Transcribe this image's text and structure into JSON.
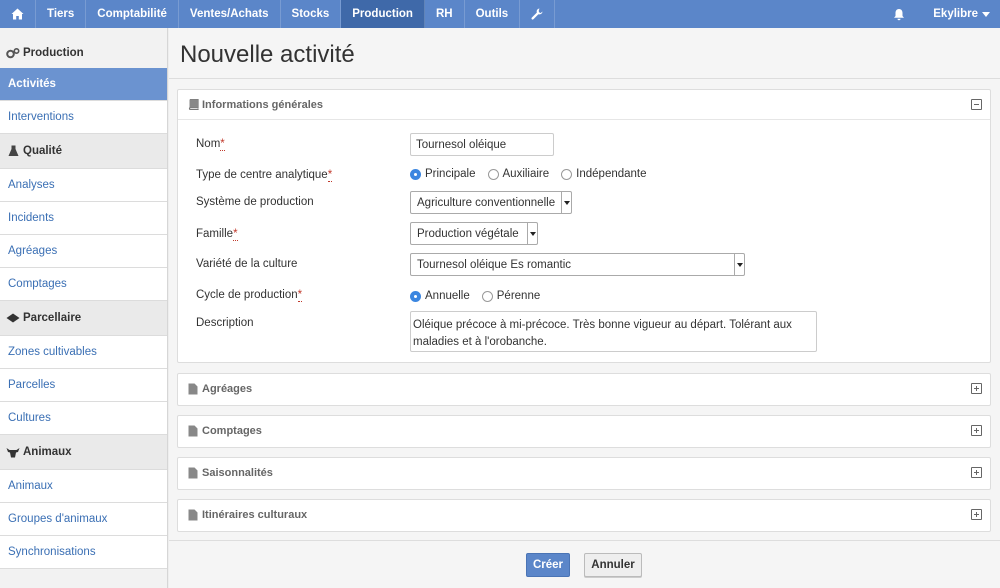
{
  "topnav": {
    "items": [
      "Tiers",
      "Comptabilité",
      "Ventes/Achats",
      "Stocks",
      "Production",
      "RH",
      "Outils"
    ],
    "active": "Production",
    "user": "Ekylibre"
  },
  "sidebar": {
    "sections": [
      {
        "title": "Production",
        "icon": "gears-icon",
        "items": [
          "Activités",
          "Interventions"
        ]
      },
      {
        "title": "Qualité",
        "icon": "flask-icon",
        "items": [
          "Analyses",
          "Incidents",
          "Agréages",
          "Comptages"
        ]
      },
      {
        "title": "Parcellaire",
        "icon": "land-icon",
        "items": [
          "Zones cultivables",
          "Parcelles",
          "Cultures"
        ]
      },
      {
        "title": "Animaux",
        "icon": "cow-icon",
        "items": [
          "Animaux",
          "Groupes d'animaux",
          "Synchronisations"
        ]
      }
    ],
    "active_item": "Activités"
  },
  "page": {
    "title": "Nouvelle activité"
  },
  "general": {
    "title": "Informations générales",
    "name_label": "Nom",
    "name_value": "Tournesol oléique",
    "cost_center_label": "Type de centre analytique",
    "cost_center_options": [
      "Principale",
      "Auxiliaire",
      "Indépendante"
    ],
    "cost_center_selected": "Principale",
    "production_system_label": "Système de production",
    "production_system_value": "Agriculture conventionnelle",
    "family_label": "Famille",
    "family_value": "Production végétale",
    "variety_label": "Variété de la culture",
    "variety_value": "Tournesol oléique Es romantic",
    "cycle_label": "Cycle de production",
    "cycle_options": [
      "Annuelle",
      "Pérenne"
    ],
    "cycle_selected": "Annuelle",
    "description_label": "Description",
    "description_value": "Oléique précoce à mi-précoce. Très bonne vigueur au départ. Tolérant aux maladies et à l'orobanche.",
    "required_mark": "*"
  },
  "collapsed_panels": [
    "Agréages",
    "Comptages",
    "Saisonnalités",
    "Itinéraires culturaux"
  ],
  "footer": {
    "create_label": "Créer",
    "cancel_label": "Annuler"
  },
  "colors": {
    "nav": "#5b86c9",
    "nav_active": "#3f69a9",
    "sidebar_active": "#6b93d0",
    "radio_on": "#3b86e0",
    "required": "#c0392b"
  }
}
